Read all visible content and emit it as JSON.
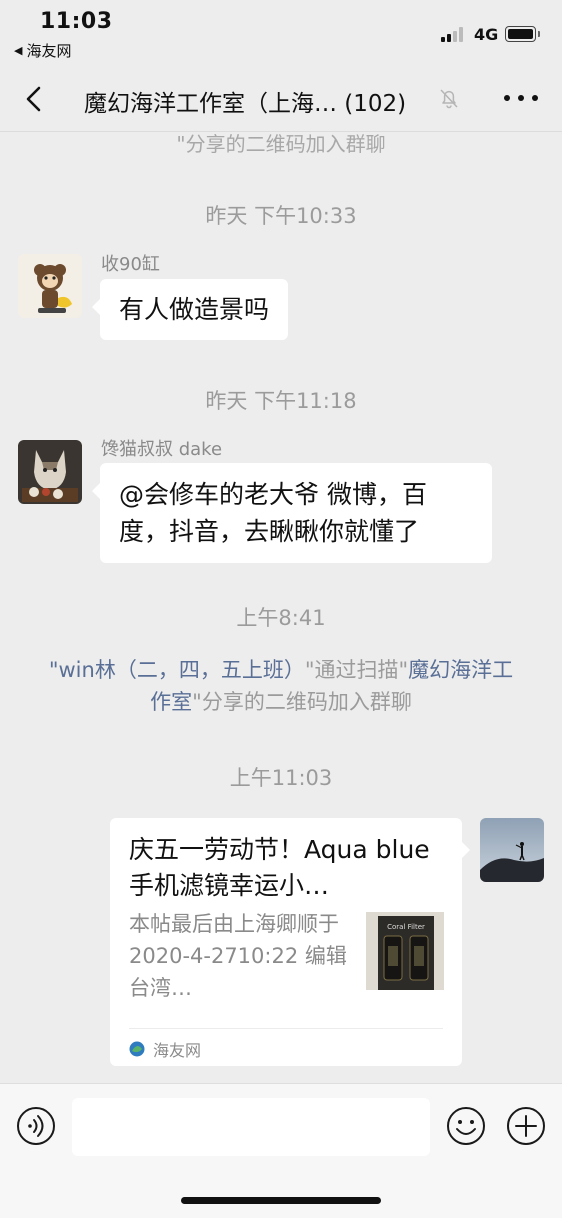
{
  "status_bar": {
    "time": "11:03",
    "back_app": "海友网",
    "network": "4G"
  },
  "nav": {
    "title": "魔幻海洋工作室（上海… (102)",
    "muted": true
  },
  "chat": {
    "partial_top_text": "\"分享的二维码加入群聊",
    "messages": [
      {
        "type": "timestamp",
        "text": "昨天 下午10:33"
      },
      {
        "type": "text",
        "sender": "收90缸",
        "text": "有人做造景吗"
      },
      {
        "type": "timestamp",
        "text": "昨天 下午11:18"
      },
      {
        "type": "text",
        "sender": "馋猫叔叔 dake",
        "text": "@会修车的老大爷 微博，百度，抖音，去瞅瞅你就懂了"
      },
      {
        "type": "timestamp",
        "text": "上午8:41"
      },
      {
        "type": "system",
        "quote_open": "\"",
        "name": "win林（二，四，五上班）",
        "middle": "\"通过扫描\"",
        "group": "魔幻海洋工作室",
        "tail": "\"分享的二维码加入群聊"
      },
      {
        "type": "timestamp",
        "text": "上午11:03"
      },
      {
        "type": "link_card",
        "sender": "self",
        "title": "庆五一劳动节！Aqua blue手机滤镜幸运小…",
        "description": "本帖最后由上海卿顺于 2020-4-2710:22 编辑台湾…",
        "thumbnail_text": "Coral Filter",
        "source": "海友网"
      }
    ]
  },
  "input": {
    "placeholder": ""
  },
  "colors": {
    "background": "#ededed",
    "bubble": "#ffffff",
    "system_link": "#5a6f96",
    "meta_text": "#9b9b9b"
  },
  "icons": [
    "back-icon",
    "mute-bell-icon",
    "more-icon",
    "voice-icon",
    "emoji-icon",
    "plus-icon",
    "source-icon"
  ]
}
